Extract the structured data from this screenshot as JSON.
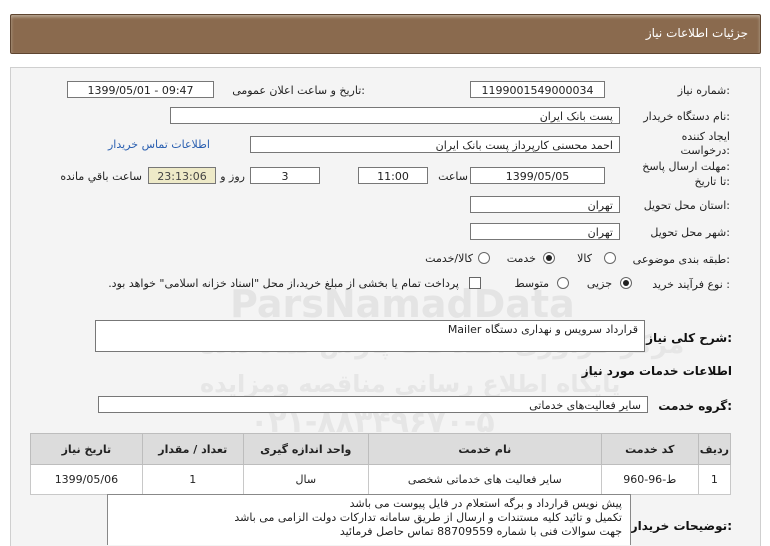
{
  "header": {
    "title": "جزئیات اطلاعات نیاز"
  },
  "watermarks": [
    "ParsNamadData",
    "مرکز فراوری اطلاعات پارس نماد داده",
    "پایگاه اطلاع رسانی مناقصه ومزایده",
    "۰۲۱-۸۸۳۴۹۶۷۰-۵"
  ],
  "form": {
    "need_number_label": "شماره نیاز:",
    "need_number": "1199001549000034",
    "announce_label": "تاریخ و ساعت اعلان عمومی:",
    "announce_value": "1399/05/01 - 09:47",
    "buyer_label": "نام دستگاه خریدار:",
    "buyer_value": "پست بانک ایران",
    "creator_label_1": "ایجاد کننده",
    "creator_label_2": "درخواست:",
    "creator_value": "احمد  محسنی کارپرداز پست بانک ایران",
    "contact_link": "اطلاعات تماس خریدار",
    "deadline_label_1": "مهلت ارسال پاسخ:",
    "deadline_label_2": "تا تاریخ:",
    "deadline_date": "1399/05/05",
    "time_label": "ساعت",
    "deadline_time": "11:00",
    "days_value": "3",
    "days_label": "روز و",
    "remaining_time": "23:13:06",
    "remaining_label": "ساعت باقي مانده",
    "province_label": "استان محل تحویل:",
    "province_value": "تهران",
    "city_label": "شهر محل تحویل:",
    "city_value": "تهران",
    "category_label": "طبقه بندی موضوعی:",
    "category_options": {
      "goods": "کالا",
      "service": "خدمت",
      "goods_service": "کالا/خدمت"
    },
    "category_selected": "خدمت",
    "process_label": "نوع فرآیند خرید :",
    "process_options": {
      "partial": "جزیی",
      "medium": "متوسط"
    },
    "process_selected": "جزیی",
    "payment_note": "پرداخت تمام یا بخشی از مبلغ خرید،از محل \"اسناد خزانه اسلامی\" خواهد بود."
  },
  "summary": {
    "label": "شرح کلی نیاز:",
    "value": "قرارداد سرویس و نهداری دستگاه Mailer"
  },
  "services": {
    "section_title": "اطلاعات خدمات مورد نیاز",
    "group_label": "گروه خدمت:",
    "group_value": "سایر فعالیت‌های خدماتی",
    "table": {
      "headers": [
        "ردیف",
        "کد خدمت",
        "نام خدمت",
        "واحد اندازه گیری",
        "تعداد / مقدار",
        "تاریخ نیاز"
      ],
      "rows": [
        [
          "1",
          "ط-96-960",
          "سایر فعالیت های خدماتی شخصی",
          "سال",
          "1",
          "1399/05/06"
        ]
      ]
    }
  },
  "notes": {
    "label": "توضیحات خریدار:",
    "lines": [
      "پیش نویس قرارداد و برگه استعلام در فایل پیوست می باشد",
      "تکمیل و تائید کلیه مستندات و ارسال از طریق سامانه تدارکات دولت الزامی می باشد",
      "جهت سوالات فنی با شماره 88709559 تماس حاصل فرمائید"
    ]
  }
}
